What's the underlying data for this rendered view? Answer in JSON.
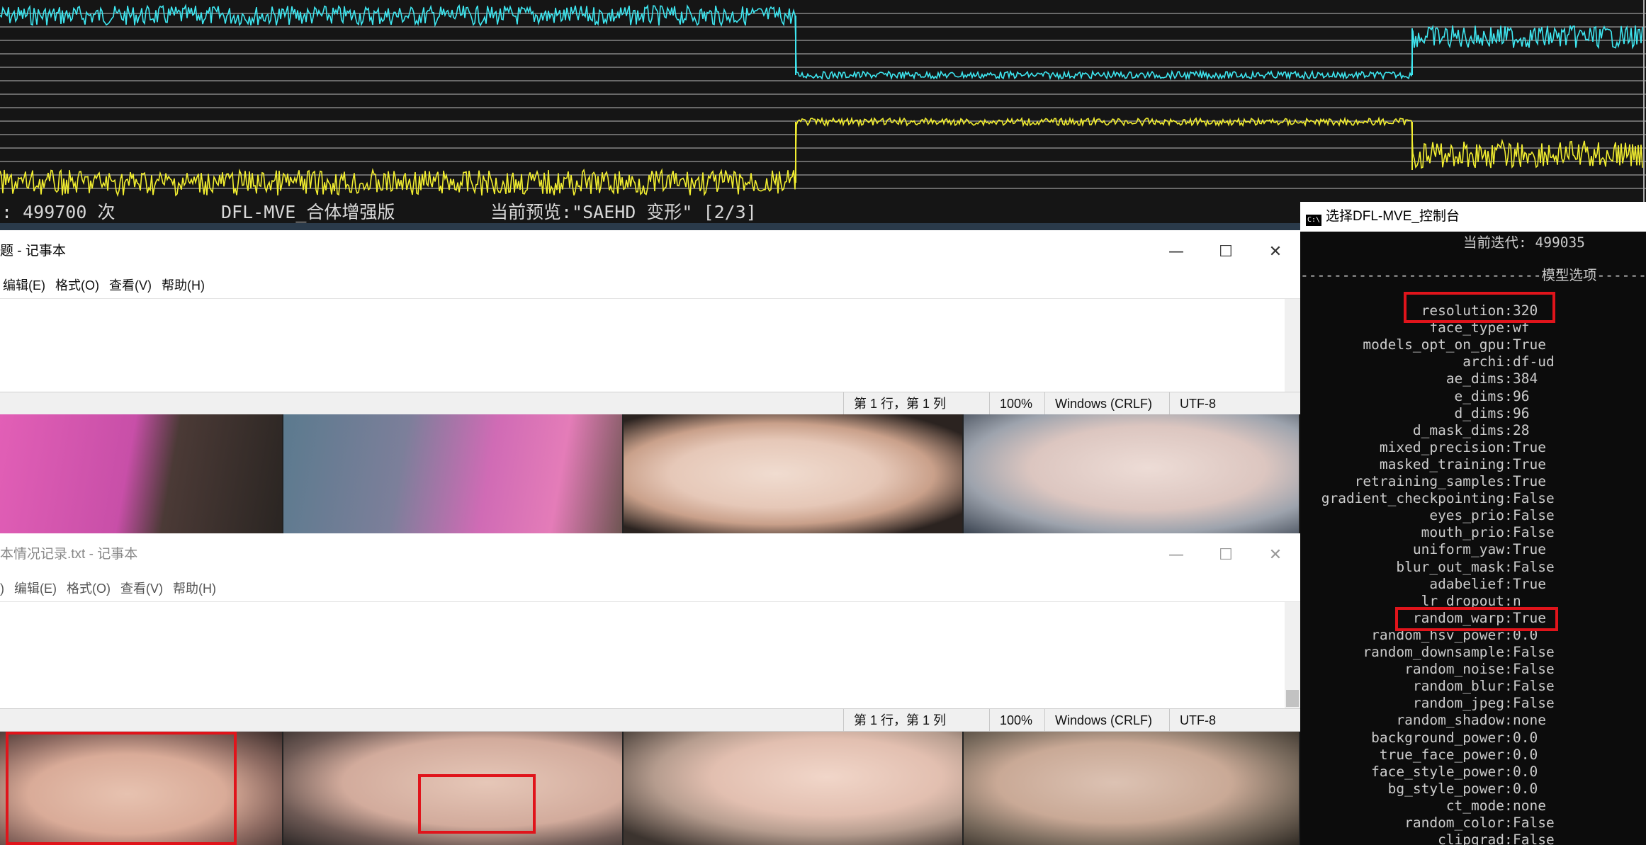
{
  "graph": {
    "status_iter": ": 499700 次",
    "status_app": "DFL-MVE_合体增强版",
    "status_preview": "当前预览:\"SAEHD 变形\" [2/3]",
    "colors": {
      "loss_src": "#3ee6f0",
      "loss_dst": "#f2ee30",
      "grid": "#bdbdbd"
    }
  },
  "notepad1": {
    "title": "题 - 记事本",
    "menu": [
      "编辑(E)",
      "格式(O)",
      "查看(V)",
      "帮助(H)"
    ],
    "status": {
      "position": "第 1 行，第 1 列",
      "zoom": "100%",
      "eol": "Windows (CRLF)",
      "encoding": "UTF-8"
    }
  },
  "notepad2": {
    "title": "本情况记录.txt - 记事本",
    "menu": [
      ")",
      "编辑(E)",
      "格式(O)",
      "查看(V)",
      "帮助(H)"
    ],
    "status": {
      "position": "第 1 行，第 1 列",
      "zoom": "100%",
      "eol": "Windows (CRLF)",
      "encoding": "UTF-8"
    }
  },
  "window_controls": {
    "minimize": "—",
    "maximize": "☐",
    "close": "✕"
  },
  "console": {
    "title": "选择DFL-MVE_控制台",
    "icon_text": "C:\\",
    "iteration": "当前迭代: 499035",
    "section": "-----------------------------模型选项------",
    "options": [
      {
        "key": "resolution",
        "value": "320"
      },
      {
        "key": "face_type",
        "value": "wf"
      },
      {
        "key": "models_opt_on_gpu",
        "value": "True"
      },
      {
        "key": "archi",
        "value": "df-ud"
      },
      {
        "key": "ae_dims",
        "value": "384"
      },
      {
        "key": "e_dims",
        "value": "96"
      },
      {
        "key": "d_dims",
        "value": "96"
      },
      {
        "key": "d_mask_dims",
        "value": "28"
      },
      {
        "key": "mixed_precision",
        "value": "True"
      },
      {
        "key": "masked_training",
        "value": "True"
      },
      {
        "key": "retraining_samples",
        "value": "True"
      },
      {
        "key": "gradient_checkpointing",
        "value": "False"
      },
      {
        "key": "eyes_prio",
        "value": "False"
      },
      {
        "key": "mouth_prio",
        "value": "False"
      },
      {
        "key": "uniform_yaw",
        "value": "True"
      },
      {
        "key": "blur_out_mask",
        "value": "False"
      },
      {
        "key": "adabelief",
        "value": "True"
      },
      {
        "key": "lr_dropout",
        "value": "n"
      },
      {
        "key": "random_warp",
        "value": "True"
      },
      {
        "key": "random_hsv_power",
        "value": "0.0"
      },
      {
        "key": "random_downsample",
        "value": "False"
      },
      {
        "key": "random_noise",
        "value": "False"
      },
      {
        "key": "random_blur",
        "value": "False"
      },
      {
        "key": "random_jpeg",
        "value": "False"
      },
      {
        "key": "random_shadow",
        "value": "none"
      },
      {
        "key": "background_power",
        "value": "0.0"
      },
      {
        "key": "true_face_power",
        "value": "0.0"
      },
      {
        "key": "face_style_power",
        "value": "0.0"
      },
      {
        "key": "bg_style_power",
        "value": "0.0"
      },
      {
        "key": "ct_mode",
        "value": "none"
      },
      {
        "key": "random_color",
        "value": "False"
      },
      {
        "key": "clipgrad",
        "value": "False"
      }
    ]
  }
}
